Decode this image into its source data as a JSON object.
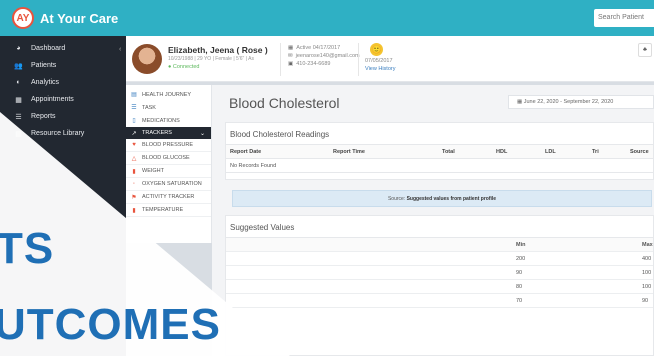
{
  "app": {
    "logo_mark": "AY",
    "name": "At Your Care",
    "search_placeholder": "Search Patient"
  },
  "sidebar": {
    "items": [
      {
        "icon": "dashboard-icon",
        "glyph": "◕",
        "label": "Dashboard"
      },
      {
        "icon": "patients-icon",
        "glyph": "👥",
        "label": "Patients"
      },
      {
        "icon": "analytics-icon",
        "glyph": "◐",
        "label": "Analytics"
      },
      {
        "icon": "calendar-icon",
        "glyph": "▦",
        "label": "Appointments"
      },
      {
        "icon": "reports-icon",
        "glyph": "☰",
        "label": "Reports"
      },
      {
        "icon": "library-icon",
        "glyph": "▤",
        "label": "Resource Library"
      }
    ],
    "collapse_glyph": "‹"
  },
  "patient": {
    "name": "Elizabeth, Jeena ( Rose )",
    "info": "10/23/1988 | 29 YO | Female | 5'6\" | As",
    "status": "Connected",
    "contact": {
      "active": "Active 04/17/2017",
      "email": "jeenarose140@gmail.com",
      "phone": "410-234-6689"
    },
    "mood_emoji": "🙂",
    "mood_date": "07/05/2017",
    "view_history": "View History",
    "action_glyph": "♣"
  },
  "submenu": {
    "items": [
      {
        "icon": "health-journey-icon",
        "glyph": "▤",
        "label": "HEALTH JOURNEY"
      },
      {
        "icon": "task-icon",
        "glyph": "☰",
        "label": "TASK"
      },
      {
        "icon": "medications-icon",
        "glyph": "▯",
        "label": "MEDICATIONS"
      }
    ],
    "trackers": {
      "glyph": "↗",
      "label": "TRACKERS",
      "chevron": "⌄"
    },
    "children": [
      {
        "icon": "blood-pressure-icon",
        "glyph": "♥",
        "label": "BLOOD PRESSURE"
      },
      {
        "icon": "blood-glucose-icon",
        "glyph": "△",
        "label": "BLOOD GLUCOSE"
      },
      {
        "icon": "weight-icon",
        "glyph": "▮",
        "label": "WEIGHT"
      },
      {
        "icon": "oxygen-icon",
        "glyph": "◦",
        "label": "OXYGEN SATURATION"
      },
      {
        "icon": "activity-icon",
        "glyph": "⚑",
        "label": "ACTIVITY TRACKER"
      },
      {
        "icon": "temperature-icon",
        "glyph": "▮",
        "label": "TEMPERATURE"
      }
    ]
  },
  "main": {
    "title": "Blood Cholesterol",
    "date_range": "June 22, 2020 - September 22, 2020",
    "readings": {
      "title": "Blood Cholesterol Readings",
      "columns": [
        "Report Date",
        "Report Time",
        "Total",
        "HDL",
        "LDL",
        "Tri",
        "Source"
      ],
      "empty": "No Records Found"
    },
    "source_note": {
      "prefix": "Source:",
      "text": "Suggested values from patient profile"
    },
    "suggested": {
      "title": "Suggested Values",
      "columns": [
        "Min",
        "Max"
      ],
      "rows": [
        {
          "min": "200",
          "max": "400"
        },
        {
          "min": "90",
          "max": "100"
        },
        {
          "min": "80",
          "max": "100"
        },
        {
          "min": "70",
          "max": "90"
        }
      ]
    }
  },
  "overlay": {
    "line1": "TS",
    "line2": "UTCOMES"
  },
  "colors": {
    "topbar": "#2fb0c4",
    "sidebar": "#222831",
    "accent_blue": "#1f6fb5",
    "logo_red": "#e8543d"
  }
}
